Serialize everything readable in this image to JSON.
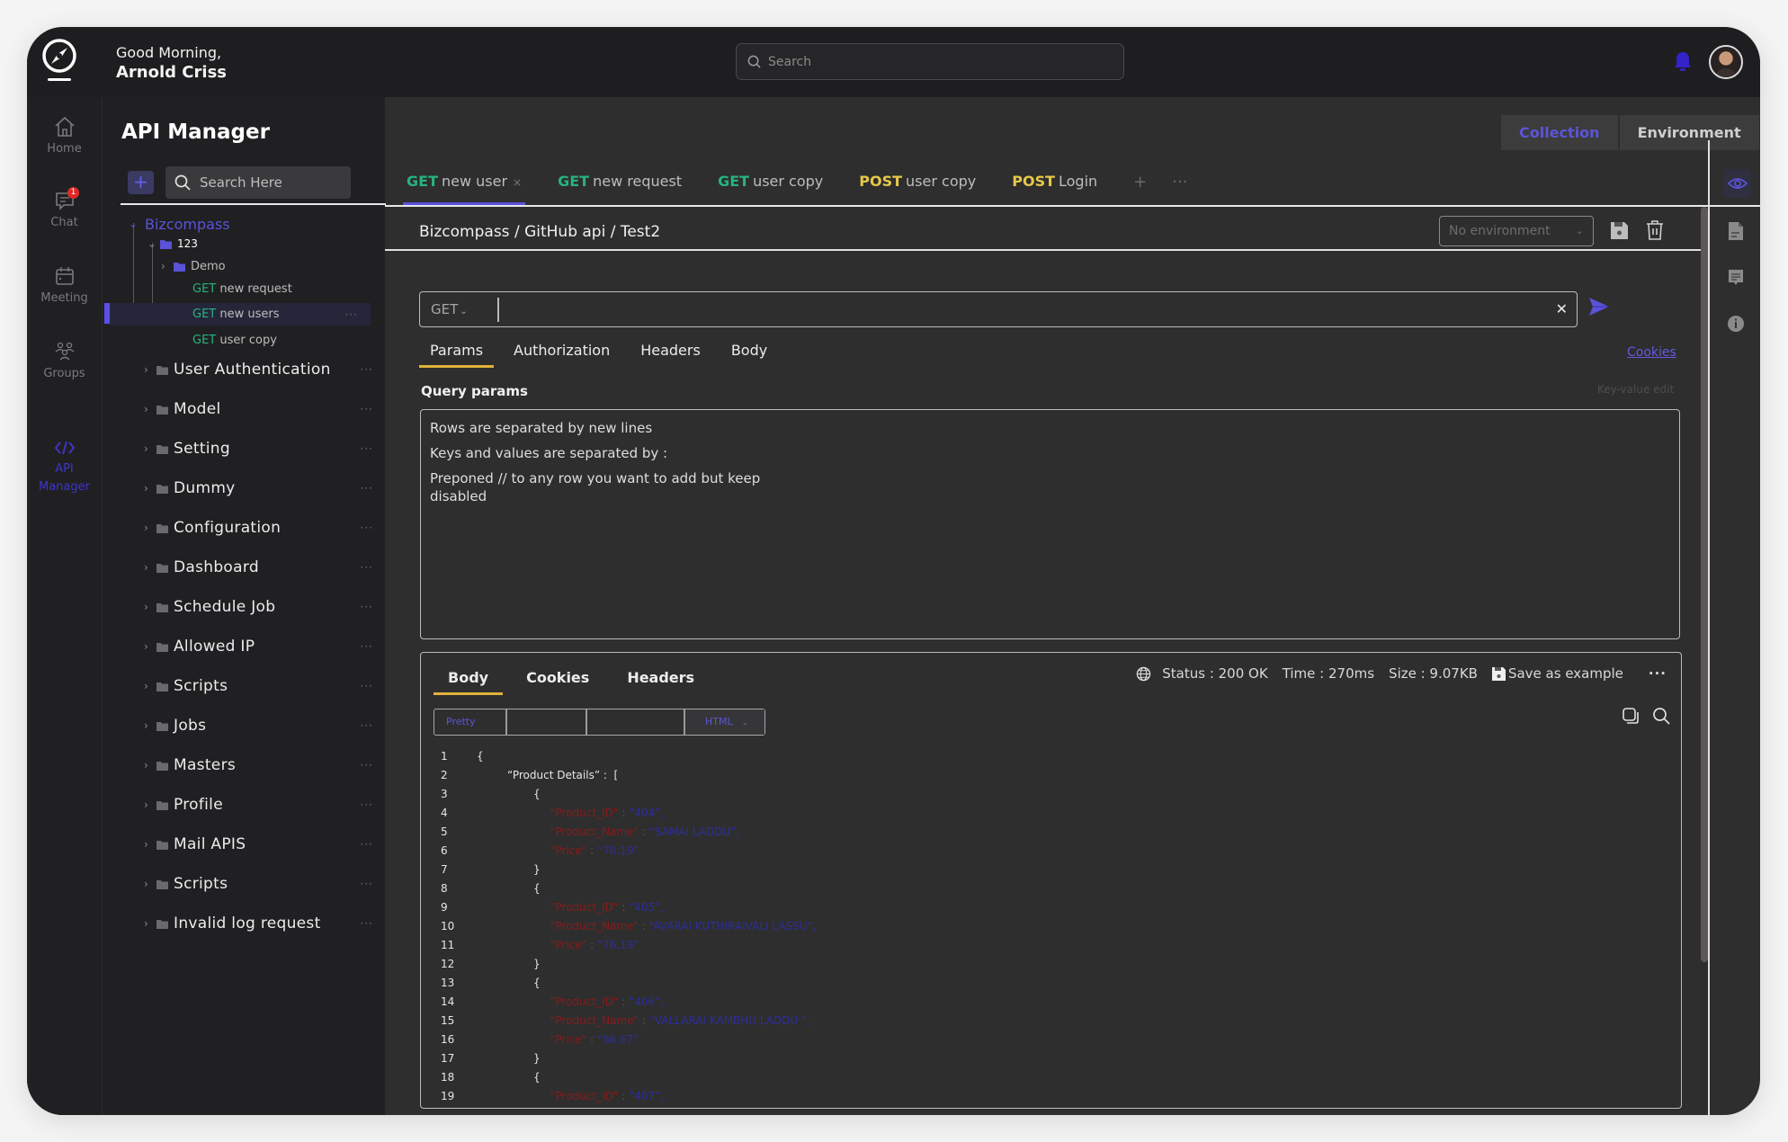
{
  "header": {
    "greeting": "Good Morning,",
    "user_name": "Arnold Criss",
    "search_placeholder": "Search",
    "notification_icon": "bell-icon",
    "avatar_icon": "user-avatar"
  },
  "rail": {
    "items": [
      {
        "label": "Home",
        "icon": "home-icon"
      },
      {
        "label": "Chat",
        "icon": "chat-icon",
        "badge": "1"
      },
      {
        "label": "Meeting",
        "icon": "calendar-icon"
      },
      {
        "label": "Groups",
        "icon": "groups-icon"
      },
      {
        "label": "API Manager",
        "icon": "code-icon",
        "active": true
      }
    ]
  },
  "sidebar": {
    "title": "API Manager",
    "add_label": "+",
    "search_placeholder": "Search Here",
    "root": "Bizcompass",
    "sub_folder": "123",
    "demo_folder": "Demo",
    "requests": [
      {
        "method": "GET",
        "name": "new request"
      },
      {
        "method": "GET",
        "name": "new users",
        "selected": true
      },
      {
        "method": "GET",
        "name": "user copy"
      }
    ],
    "folders": [
      "User Authentication",
      "Model",
      "Setting",
      "Dummy",
      "Configuration",
      "Dashboard",
      "Schedule Job",
      "Allowed IP",
      "Scripts",
      "Jobs",
      "Masters",
      "Profile",
      "Mail APIS",
      "Scripts",
      "Invalid log request"
    ],
    "more_label": "···"
  },
  "main": {
    "toggle": {
      "collection": "Collection",
      "environment": "Environment",
      "active": "Collection"
    },
    "tabs": [
      {
        "method": "GET",
        "name": "new user",
        "active": true,
        "close": "×"
      },
      {
        "method": "GET",
        "name": "new request"
      },
      {
        "method": "GET",
        "name": "user copy"
      },
      {
        "method": "POST",
        "name": "user copy"
      },
      {
        "method": "POST",
        "name": "Login"
      }
    ],
    "tab_add": "+",
    "tab_more": "···",
    "breadcrumb": "Bizcompass / GitHub api / Test2",
    "environment_select": "No environment",
    "url": {
      "method": "GET",
      "value": "",
      "clear": "✕"
    },
    "request_tabs": [
      "Params",
      "Authorization",
      "Headers",
      "Body"
    ],
    "active_request_tab": "Params",
    "cookies_link": "Cookies",
    "query_params_label": "Query params",
    "key_value_edit": "Key-value edit",
    "query_help": [
      "Rows are separated by new lines",
      "Keys and values are separated by :",
      "Preponed // to any row you want to add but keep disabled"
    ]
  },
  "response": {
    "tabs": [
      "Body",
      "Cookies",
      "Headers"
    ],
    "active_tab": "Body",
    "status": "Status : 200 OK",
    "time": "Time : 270ms",
    "size": "Size : 9.07KB",
    "save_example": "Save as example",
    "more": "···",
    "format": {
      "pretty": "Pretty",
      "type": "HTML"
    },
    "code_lines": [
      {
        "n": "1",
        "indent": 0,
        "parts": [
          {
            "t": "{",
            "c": "punc"
          }
        ]
      },
      {
        "n": "2",
        "indent": 1,
        "parts": [
          {
            "t": "“Product Details” :  [",
            "c": "punc"
          }
        ]
      },
      {
        "n": "3",
        "indent": 2,
        "parts": [
          {
            "t": "{",
            "c": "punc"
          }
        ]
      },
      {
        "n": "4",
        "indent": 3,
        "parts": [
          {
            "t": "\"Product_ID\"",
            "c": "key"
          },
          {
            "t": " : ",
            "c": "sep"
          },
          {
            "t": "“404”,",
            "c": "val"
          }
        ]
      },
      {
        "n": "5",
        "indent": 3,
        "parts": [
          {
            "t": "\"Product_Name\"",
            "c": "key"
          },
          {
            "t": " : ",
            "c": "sep"
          },
          {
            "t": "“SAMAI LADDU”,",
            "c": "val"
          }
        ]
      },
      {
        "n": "6",
        "indent": 3,
        "parts": [
          {
            "t": "\"Price\"",
            "c": "key"
          },
          {
            "t": " : ",
            "c": "sep"
          },
          {
            "t": "“76.19”",
            "c": "val"
          }
        ]
      },
      {
        "n": "7",
        "indent": 2,
        "parts": [
          {
            "t": "}",
            "c": "punc"
          }
        ]
      },
      {
        "n": "8",
        "indent": 2,
        "parts": [
          {
            "t": "{",
            "c": "punc"
          }
        ]
      },
      {
        "n": "9",
        "indent": 3,
        "parts": [
          {
            "t": "\"Product_ID\"",
            "c": "key"
          },
          {
            "t": " : ",
            "c": "sep"
          },
          {
            "t": "“405”,",
            "c": "val"
          }
        ]
      },
      {
        "n": "10",
        "indent": 3,
        "parts": [
          {
            "t": "\"Product_Name\"",
            "c": "key"
          },
          {
            "t": " : ",
            "c": "sep"
          },
          {
            "t": "“AVARAI KUTHIRAIVALI LASSU”,",
            "c": "val"
          }
        ]
      },
      {
        "n": "11",
        "indent": 3,
        "parts": [
          {
            "t": "\"Price\"",
            "c": "key"
          },
          {
            "t": " : ",
            "c": "sep"
          },
          {
            "t": "“76.19”",
            "c": "val"
          }
        ]
      },
      {
        "n": "12",
        "indent": 2,
        "parts": [
          {
            "t": "}",
            "c": "punc"
          }
        ]
      },
      {
        "n": "13",
        "indent": 2,
        "parts": [
          {
            "t": "{",
            "c": "punc"
          }
        ]
      },
      {
        "n": "14",
        "indent": 3,
        "parts": [
          {
            "t": "\"Product_ID\"",
            "c": "key"
          },
          {
            "t": " : ",
            "c": "sep"
          },
          {
            "t": "“406”,",
            "c": "val"
          }
        ]
      },
      {
        "n": "15",
        "indent": 3,
        "parts": [
          {
            "t": "\"Product_Name\"",
            "c": "key"
          },
          {
            "t": " : ",
            "c": "sep"
          },
          {
            "t": "“VALLARAI KAMBHU LADDU ”,",
            "c": "val"
          }
        ]
      },
      {
        "n": "16",
        "indent": 3,
        "parts": [
          {
            "t": "\"Price\"",
            "c": "key"
          },
          {
            "t": " : ",
            "c": "sep"
          },
          {
            "t": "“66.67”",
            "c": "val"
          }
        ]
      },
      {
        "n": "17",
        "indent": 2,
        "parts": [
          {
            "t": "}",
            "c": "punc"
          }
        ]
      },
      {
        "n": "18",
        "indent": 2,
        "parts": [
          {
            "t": "{",
            "c": "punc"
          }
        ]
      },
      {
        "n": "19",
        "indent": 3,
        "parts": [
          {
            "t": "\"Product_ID\"",
            "c": "key"
          },
          {
            "t": " : ",
            "c": "sep"
          },
          {
            "t": "“407”,",
            "c": "val"
          }
        ]
      }
    ]
  },
  "colors": {
    "accent": "#5a52d8",
    "get": "#27b37e",
    "post": "#e6c84a",
    "tab_underline": "#e0b23a",
    "badge": "#e02a2a"
  }
}
